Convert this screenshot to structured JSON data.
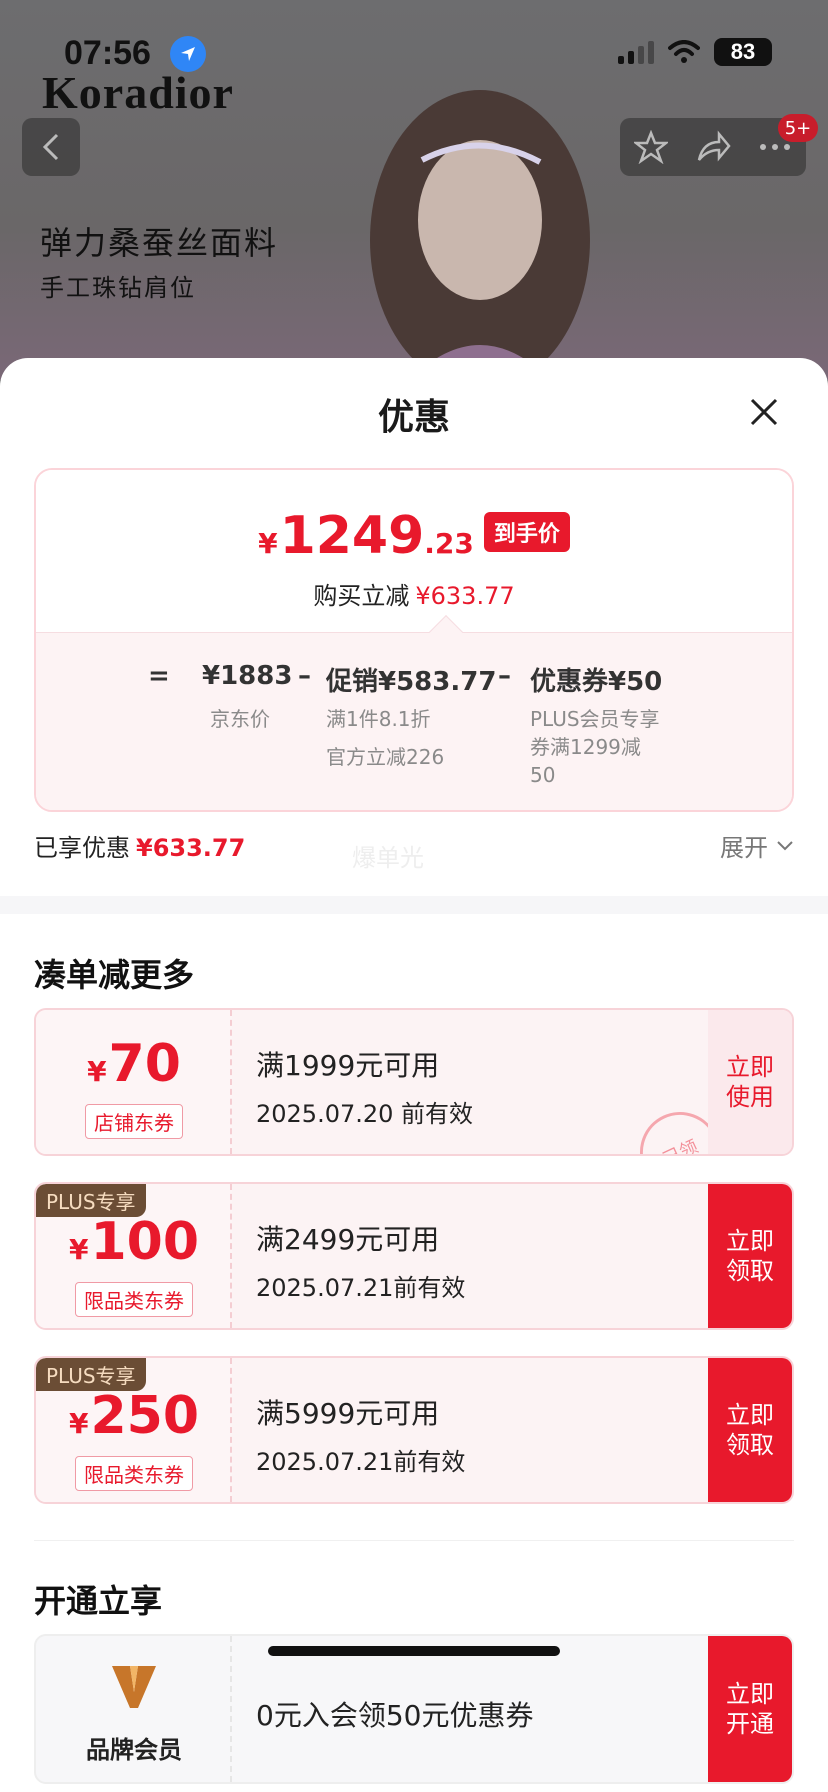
{
  "status_bar": {
    "time": "07:56",
    "battery": "83"
  },
  "hero": {
    "brand": "Koradior",
    "line1": "弹力桑蚕丝面料",
    "line2": "手工珠钻肩位",
    "badge": "5+"
  },
  "sheet": {
    "title": "优惠",
    "price": {
      "yen": "¥",
      "int": "1249",
      "dec": ".23",
      "tag": "到手价"
    },
    "reduction": {
      "label": "购买立减",
      "value": "¥633.77"
    },
    "formula": {
      "eq": "=",
      "base": "¥1883",
      "minus1": "–",
      "promo": "促销¥583.77",
      "minus2": "–",
      "coupon": "优惠券¥50",
      "base_label": "京东价",
      "promo_note1": "满1件8.1折",
      "promo_note2": "官方立减226",
      "coupon_note": "PLUS会员专享券满1299减50"
    },
    "enjoyed": {
      "label": "已享优惠",
      "value": "¥633.77",
      "expand": "展开",
      "watermark": "爆单光"
    }
  },
  "more": {
    "title": "凑单减更多",
    "coupons": [
      {
        "plus": "",
        "yen": "¥",
        "amount": "70",
        "type": "店铺东券",
        "cond": "满1999元可用",
        "date": "2025.07.20 前有效",
        "btn": "立即使用",
        "btn1": "立即",
        "btn2": "使用",
        "stamp": "已领"
      },
      {
        "plus": "PLUS专享",
        "yen": "¥",
        "amount": "100",
        "type": "限品类东券",
        "cond": "满2499元可用",
        "date": "2025.07.21前有效",
        "btn1": "立即",
        "btn2": "领取"
      },
      {
        "plus": "PLUS专享",
        "yen": "¥",
        "amount": "250",
        "type": "限品类东券",
        "cond": "满5999元可用",
        "date": "2025.07.21前有效",
        "btn1": "立即",
        "btn2": "领取"
      }
    ]
  },
  "open": {
    "title": "开通立享",
    "member_name": "品牌会员",
    "text": "0元入会领50元优惠券",
    "btn1": "立即",
    "btn2": "开通"
  },
  "colors": {
    "accent": "#e8192c",
    "plus_bg": "#6b4d35"
  }
}
